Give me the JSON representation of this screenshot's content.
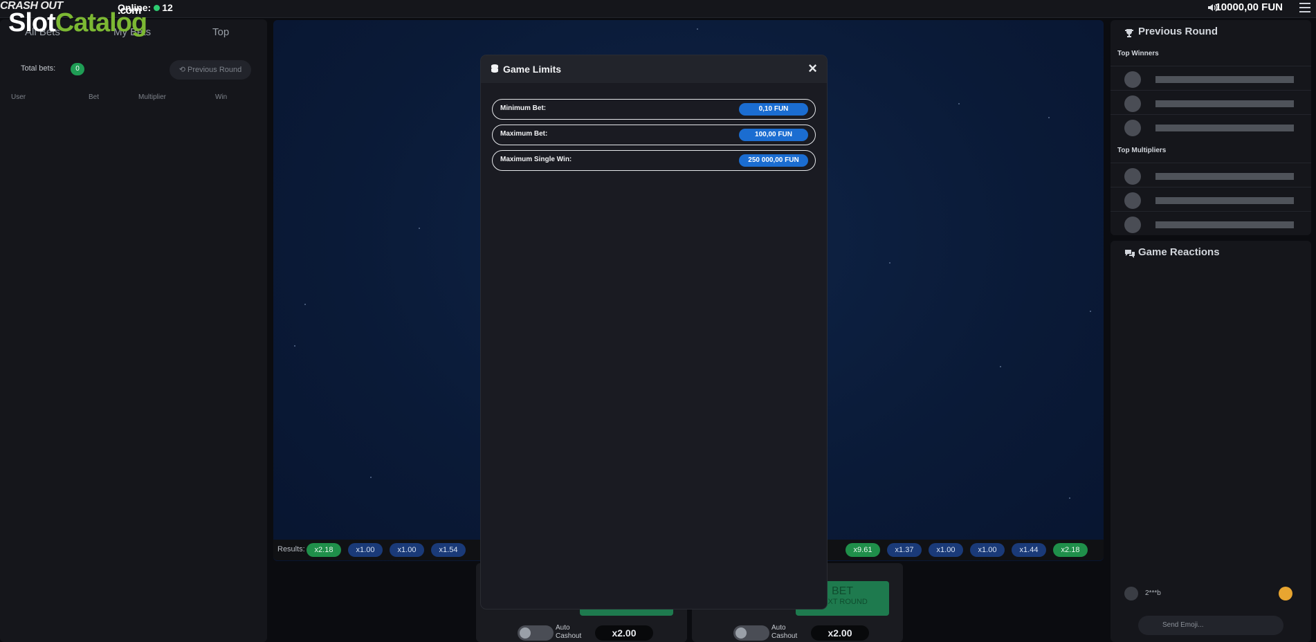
{
  "topbar": {
    "logo": "CRASH OUT",
    "online_label": "Online:",
    "online_count": "12",
    "watermark_slot": "Slot",
    "watermark_catalog": "Catalog",
    "watermark_com": ".com",
    "balance": "10000,00 FUN"
  },
  "left": {
    "tabs": [
      "All Bets",
      "My Bets",
      "Top"
    ],
    "total_bets_label": "Total bets:",
    "total_bets_count": "0",
    "previous_round_label": "Previous Round",
    "columns": [
      "User",
      "Bet",
      "Multiplier",
      "Win"
    ]
  },
  "results": {
    "label": "Results:",
    "left_pills": [
      {
        "value": "x2.18",
        "color": "green"
      },
      {
        "value": "x1.00",
        "color": "blue"
      },
      {
        "value": "x1.00",
        "color": "blue"
      },
      {
        "value": "x1.54",
        "color": "blue"
      }
    ],
    "right_pills": [
      {
        "value": "x9.61",
        "color": "green"
      },
      {
        "value": "x1.37",
        "color": "blue"
      },
      {
        "value": "x1.00",
        "color": "blue"
      },
      {
        "value": "x1.00",
        "color": "blue"
      },
      {
        "value": "x1.44",
        "color": "blue"
      },
      {
        "value": "x2.18",
        "color": "green"
      }
    ]
  },
  "bet_panels": [
    {
      "auto_label_1": "Auto",
      "auto_label_2": "Cashout",
      "multiplier": "x2.00"
    },
    {
      "bet_label": "BET",
      "bet_sub": "NEXT ROUND",
      "auto_label_1": "Auto",
      "auto_label_2": "Cashout",
      "multiplier": "x2.00"
    }
  ],
  "previous_round": {
    "title": "Previous Round",
    "top_winners": "Top Winners",
    "top_multipliers": "Top Multipliers"
  },
  "reactions": {
    "title": "Game Reactions",
    "user": "2***b",
    "input_placeholder": "Send Emoji..."
  },
  "modal": {
    "title": "Game Limits",
    "close": "×",
    "limits": [
      {
        "label": "Minimum Bet:",
        "value": "0,10 FUN"
      },
      {
        "label": "Maximum Bet:",
        "value": "100,00 FUN"
      },
      {
        "label": "Maximum Single Win:",
        "value": "250 000,00 FUN"
      }
    ]
  },
  "colors": {
    "accent_blue": "#1b6dd1",
    "pill_green": "#1f8f4a",
    "pill_blue": "#1a3a78",
    "bet_green": "#1e7a4e"
  }
}
